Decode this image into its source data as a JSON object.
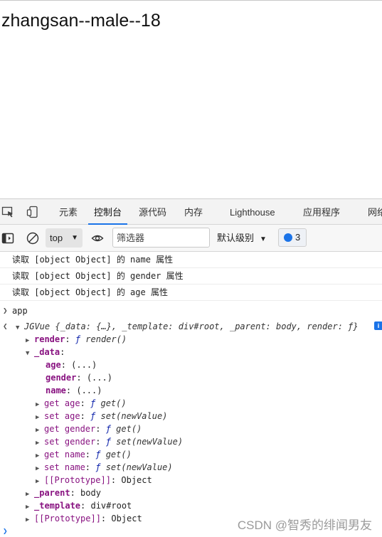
{
  "page": {
    "heading": "zhangsan--male--18"
  },
  "devtools": {
    "tabs": [
      "元素",
      "控制台",
      "源代码",
      "内存",
      "Lighthouse",
      "应用程序",
      "网络"
    ],
    "toolbar": {
      "context": "top",
      "filter_placeholder": "筛选器",
      "levels": "默认级别",
      "issues_count": "3"
    },
    "logs": [
      "读取 [object Object] 的 name 属性",
      "读取 [object Object] 的 gender 属性",
      "读取 [object Object] 的 age 属性"
    ],
    "input": "app",
    "result": {
      "summary": "JGVue {_data: {…}, _template: div#root, _parent: body, render: ƒ}",
      "render_key": "render",
      "render_val": "render()",
      "data_key": "_data",
      "age_key": "age",
      "gender_key": "gender",
      "name_key": "name",
      "lazy": "(...)",
      "get_age": "get age",
      "set_age": "set age",
      "get_gender": "get gender",
      "set_gender": "set gender",
      "get_name": "get name",
      "set_name": "set name",
      "get_fn": "get()",
      "set_fn": "set(newValue)",
      "proto_key": "[[Prototype]]",
      "proto_val": "Object",
      "parent_key": "_parent",
      "parent_val": "body",
      "template_key": "_template",
      "template_val": "div#root"
    }
  },
  "watermark": "CSDN @智秀的绯闻男友"
}
